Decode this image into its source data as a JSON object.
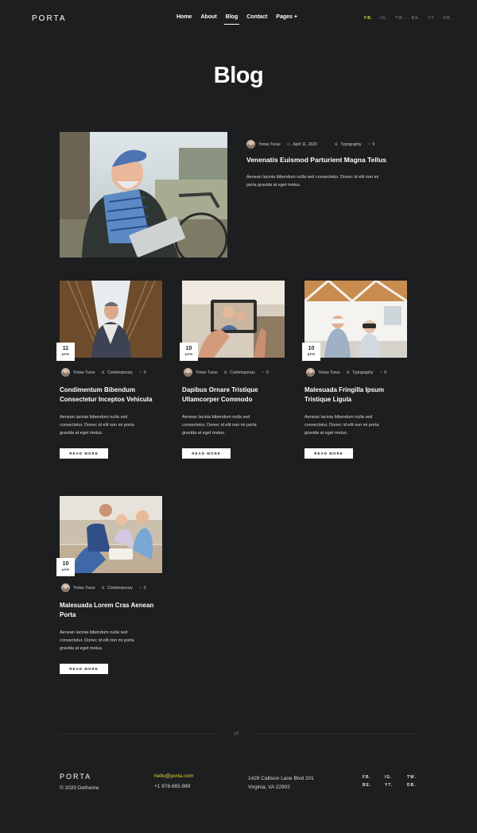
{
  "header": {
    "logo": "PORTA",
    "nav": [
      {
        "label": "Home"
      },
      {
        "label": "About"
      },
      {
        "label": "Blog",
        "active": true
      },
      {
        "label": "Contact"
      },
      {
        "label": "Pages +"
      }
    ],
    "social": [
      "FB.",
      "IG.",
      "TW.",
      "BE.",
      "YT.",
      "DB."
    ]
  },
  "page_title": "Blog",
  "featured": {
    "author": "Yorias Turus",
    "date": "April 11, 2020",
    "category": "Typography",
    "comments": "0",
    "title": "Venenatis Euismod Parturient Magna Tellus",
    "excerpt_line1": "Aenean lacinia bibendum nulla sed consectetur. Donec id elit non mi",
    "excerpt_line2": "porta gravida at eget metus."
  },
  "posts": [
    {
      "day": "11",
      "month": "APR",
      "author": "Yorias Turus",
      "category": "Contemporary",
      "comments": "0",
      "title_line1": "Condimentum Bibendum",
      "title_line2": "Consectetur Inceptos Vehicula",
      "excerpt_line1": "Aenean lacinia bibendum nulla sed",
      "excerpt_line2": "consectetur. Donec id elit non mi porta",
      "excerpt_line3": "gravida at eget metus.",
      "read_more": "READ MORE"
    },
    {
      "day": "10",
      "month": "APR",
      "author": "Yorias Turus",
      "category": "Contemporary",
      "comments": "0",
      "title_line1": "Dapibus Ornare Tristique",
      "title_line2": "Ullamcorper Commodo",
      "excerpt_line1": "Aenean lacinia bibendum nulla sed",
      "excerpt_line2": "consectetur. Donec id elit non mi porta",
      "excerpt_line3": "gravida at eget metus.",
      "read_more": "READ MORE"
    },
    {
      "day": "10",
      "month": "APR",
      "author": "Yorias Turus",
      "category": "Typography",
      "comments": "0",
      "title_line1": "Malesuada Fringilla Ipsum",
      "title_line2": "Tristique Ligula",
      "excerpt_line1": "Aenean lacinia bibendum nulla sed",
      "excerpt_line2": "consectetur. Donec id elit non mi porta",
      "excerpt_line3": "gravida at eget metus.",
      "read_more": "READ MORE"
    },
    {
      "day": "10",
      "month": "APR",
      "author": "Yorias Turus",
      "category": "Contemporary",
      "comments": "0",
      "title_line1": "Malesuada Lorem Cras Aenean",
      "title_line2": "Porta",
      "excerpt_line1": "Aenean lacinia bibendum nulla sed",
      "excerpt_line2": "consectetur. Donec id elit non mi porta",
      "excerpt_line3": "gravida at eget metus.",
      "read_more": "READ MORE"
    }
  ],
  "footer": {
    "logo": "PORTA",
    "copyright": "© 2020 Detheme",
    "email": "hello@porta.com",
    "phone": "+1 876.665.989",
    "address_line1": "1428 Callison Lane Blvd 201",
    "address_line2": "Virginia, VA 22902",
    "social": [
      "FB.",
      "IG.",
      "TW.",
      "BE.",
      "YT.",
      "DB."
    ]
  },
  "colors": {
    "background": "#1d1e20",
    "accent": "#e6dd2a",
    "text": "#ffffff"
  },
  "icons": {
    "calendar": "calendar-icon",
    "category": "category-icon",
    "comment": "comment-icon",
    "divider": "shuffle-icon"
  }
}
